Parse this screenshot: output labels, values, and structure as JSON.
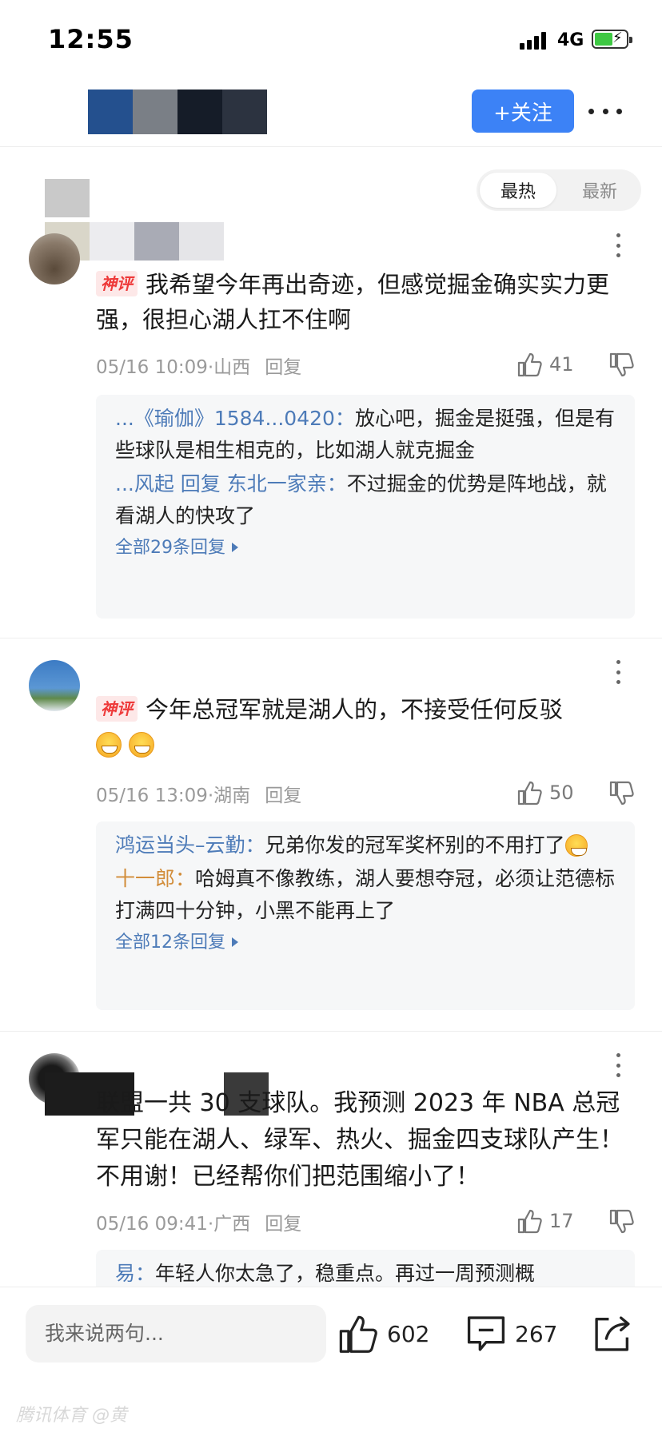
{
  "status_bar": {
    "time": "12:55",
    "network": "4G"
  },
  "header": {
    "follow_label": "+关注"
  },
  "sort_tabs": {
    "hot": "最热",
    "new": "最新"
  },
  "comments": [
    {
      "badge": "神评",
      "text": "我希望今年再出奇迹，但感觉掘金确实实力更强，很担心湖人扛不住啊",
      "time_location": "05/16 10:09·山西",
      "reply_label": "回复",
      "likes": "41",
      "replies": [
        {
          "name": "...《瑜伽》1584...0420：",
          "text": "放心吧，掘金是挺强，但是有些球队是相生相克的，比如湖人就克掘金"
        },
        {
          "name": "...风起 回复 东北一家亲：",
          "text": "不过掘金的优势是阵地战，就看湖人的快攻了"
        }
      ],
      "see_all": "全部29条回复"
    },
    {
      "badge": "神评",
      "text": "今年总冠军就是湖人的，不接受任何反驳",
      "time_location": "05/16 13:09·湖南",
      "reply_label": "回复",
      "likes": "50",
      "replies": [
        {
          "name": "鸿运当头–云勤：",
          "text": "兄弟你发的冠军奖杯别的不用打了"
        },
        {
          "name": "十一郎：",
          "text": "哈姆真不像教练，湖人要想夺冠，必须让范德标打满四十分钟，小黑不能再上了"
        }
      ],
      "see_all": "全部12条回复"
    },
    {
      "text": "联盟一共 30 支球队。我预测 2023 年 NBA 总冠军只能在湖人、绿军、热火、掘金四支球队产生！不用谢！已经帮你们把范围缩小了！",
      "time_location": "05/16 09:41·广西",
      "reply_label": "回复",
      "likes": "17",
      "replies": [
        {
          "name": "易：",
          "text": "年轻人你太急了，稳重点。再过一周预测概"
        }
      ]
    }
  ],
  "bottom_bar": {
    "input_placeholder": "我来说两句...",
    "like_count": "602",
    "comment_count": "267"
  },
  "watermark": "腾讯体育 @黄",
  "colors": {
    "accent": "#3c82f6",
    "badge": "#ee3a3a",
    "reply_name": "#4d7bb8"
  },
  "icons": [
    "signal-icon",
    "battery-icon",
    "more-icon",
    "thumb-up-icon",
    "thumb-down-icon",
    "comment-icon",
    "share-icon"
  ]
}
